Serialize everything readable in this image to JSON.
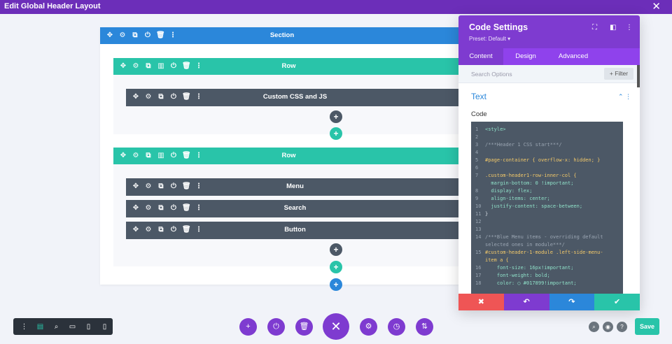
{
  "app": {
    "title": "Edit Global Header Layout",
    "close_icon": "✕"
  },
  "builder": {
    "section": {
      "label": "Section",
      "tools": [
        "✥",
        "⚙",
        "⧉",
        "⏻",
        "🗑",
        "⋮"
      ]
    },
    "rows": [
      {
        "label": "Row",
        "tools": [
          "✥",
          "⚙",
          "⧉",
          "▥",
          "⏻",
          "🗑",
          "⋮"
        ],
        "modules": [
          {
            "label": "Custom CSS and JS"
          }
        ]
      },
      {
        "label": "Row",
        "tools": [
          "✥",
          "⚙",
          "⧉",
          "▥",
          "⏻",
          "🗑",
          "⋮"
        ],
        "modules": [
          {
            "label": "Menu"
          },
          {
            "label": "Search"
          },
          {
            "label": "Button"
          }
        ]
      }
    ],
    "module_tools": [
      "✥",
      "⚙",
      "⧉",
      "⏻",
      "🗑",
      "⋮"
    ],
    "add_symbol": "+"
  },
  "panel": {
    "title": "Code Settings",
    "preset": "Preset: Default ▾",
    "header_icons": [
      "⛶",
      "◧",
      "⋮"
    ],
    "tabs": [
      {
        "label": "Content",
        "active": true
      },
      {
        "label": "Design",
        "active": false
      },
      {
        "label": "Advanced",
        "active": false
      }
    ],
    "search_placeholder": "Search Options",
    "filter_label": "+ Filter",
    "group_title": "Text",
    "group_icons": "⌃  ⋮",
    "code_label": "Code",
    "code_lines": [
      {
        "n": "1",
        "t": "<style>",
        "c": "#8fe0c8"
      },
      {
        "n": "2",
        "t": "",
        "c": "#d8dee6"
      },
      {
        "n": "3",
        "t": "/***Header 1 CSS start***/",
        "c": "#9aa5b2"
      },
      {
        "n": "4",
        "t": "",
        "c": "#d8dee6"
      },
      {
        "n": "5",
        "t": "#page-container { overflow-x: hidden; }",
        "c": "#f3c969"
      },
      {
        "n": "6",
        "t": "",
        "c": "#d8dee6"
      },
      {
        "n": "7",
        "t": ".custom-header1-row-inner-col {",
        "c": "#f3c969"
      },
      {
        "n": "",
        "t": "  margin-bottom: 0 !important;",
        "c": "#8fe0c8"
      },
      {
        "n": "8",
        "t": "  display: flex;",
        "c": "#8fe0c8"
      },
      {
        "n": "9",
        "t": "  align-items: center;",
        "c": "#8fe0c8"
      },
      {
        "n": "10",
        "t": "  justify-content: space-between;",
        "c": "#8fe0c8"
      },
      {
        "n": "11",
        "t": "}",
        "c": "#d8dee6"
      },
      {
        "n": "12",
        "t": "",
        "c": "#d8dee6"
      },
      {
        "n": "13",
        "t": "",
        "c": "#d8dee6"
      },
      {
        "n": "14",
        "t": "/***Blue Menu items - overriding default",
        "c": "#9aa5b2"
      },
      {
        "n": "",
        "t": "selected ones in module***/",
        "c": "#9aa5b2"
      },
      {
        "n": "15",
        "t": "#custom-header-1-module .left-side-menu-",
        "c": "#f3c969"
      },
      {
        "n": "",
        "t": "item a {",
        "c": "#f3c969"
      },
      {
        "n": "16",
        "t": "    font-size: 16px!important;",
        "c": "#8fe0c8"
      },
      {
        "n": "17",
        "t": "    font-weight: bold;",
        "c": "#8fe0c8"
      },
      {
        "n": "18",
        "t": "    color: ○ #017899!important;",
        "c": "#8fe0c8"
      }
    ],
    "actions": [
      {
        "name": "discard",
        "symbol": "✖",
        "color": "#ef5555"
      },
      {
        "name": "undo",
        "symbol": "↶",
        "color": "#7e3bd0"
      },
      {
        "name": "redo",
        "symbol": "↷",
        "color": "#2b87da"
      },
      {
        "name": "confirm",
        "symbol": "✔",
        "color": "#29c4a9"
      }
    ]
  },
  "dock": {
    "left_icons": [
      "⋮",
      "▤",
      "⌕",
      "▭",
      "▯",
      "▯"
    ],
    "center_buttons": [
      "+",
      "⏻",
      "🗑",
      "⚙",
      "◷",
      "⇅"
    ],
    "center_main": "✕",
    "right_icons": [
      "⌕",
      "◉",
      "?"
    ],
    "save_label": "Save"
  }
}
